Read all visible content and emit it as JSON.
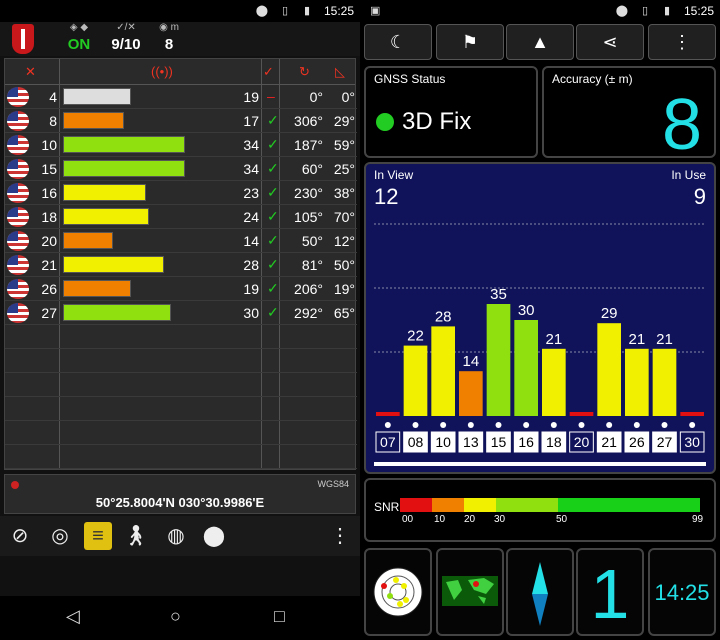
{
  "status_bar": {
    "time": "15:25",
    "battery": "battery-icon",
    "wifi": "vibrate-icon",
    "location": "location-icon"
  },
  "left": {
    "header": {
      "status_label": "ON",
      "sats_label": "9/10",
      "alt_label": "8"
    },
    "table": {
      "columns": [
        "sat-icon",
        "snr-icon",
        "used-icon",
        "azimuth-icon",
        "elevation-icon"
      ],
      "rows": [
        {
          "prn": "4",
          "snr": "19",
          "used": "",
          "az": "0°",
          "el": "0°",
          "snr_value": 19,
          "color": "#dddddd"
        },
        {
          "prn": "8",
          "snr": "17",
          "used": "✓",
          "az": "306°",
          "el": "29°",
          "snr_value": 17,
          "color": "#f08000"
        },
        {
          "prn": "10",
          "snr": "34",
          "used": "✓",
          "az": "187°",
          "el": "59°",
          "snr_value": 34,
          "color": "#90e010"
        },
        {
          "prn": "15",
          "snr": "34",
          "used": "✓",
          "az": "60°",
          "el": "25°",
          "snr_value": 34,
          "color": "#90e010"
        },
        {
          "prn": "16",
          "snr": "23",
          "used": "✓",
          "az": "230°",
          "el": "38°",
          "snr_value": 23,
          "color": "#f0f000"
        },
        {
          "prn": "18",
          "snr": "24",
          "used": "✓",
          "az": "105°",
          "el": "70°",
          "snr_value": 24,
          "color": "#f0f000"
        },
        {
          "prn": "20",
          "snr": "14",
          "used": "✓",
          "az": "50°",
          "el": "12°",
          "snr_value": 14,
          "color": "#f08000"
        },
        {
          "prn": "21",
          "snr": "28",
          "used": "✓",
          "az": "81°",
          "el": "50°",
          "snr_value": 28,
          "color": "#f0f000"
        },
        {
          "prn": "26",
          "snr": "19",
          "used": "✓",
          "az": "206°",
          "el": "19°",
          "snr_value": 19,
          "color": "#f08000"
        },
        {
          "prn": "27",
          "snr": "30",
          "used": "✓",
          "az": "292°",
          "el": "65°",
          "snr_value": 30,
          "color": "#90e010"
        }
      ]
    },
    "coords": {
      "datum": "WGS84",
      "value": "50°25.8004'N  030°30.9986'E"
    },
    "tools": [
      "compass-icon",
      "radar-icon",
      "table-icon",
      "walk-icon",
      "globe-icon",
      "pin-icon",
      "more-icon"
    ]
  },
  "right": {
    "toolbar": [
      "moon-icon",
      "person-flag-icon",
      "navigate-icon",
      "share-icon",
      "more-icon"
    ],
    "gnss": {
      "title": "GNSS Status",
      "fix": "3D Fix"
    },
    "accuracy": {
      "title": "Accuracy (± m)",
      "value": "8"
    },
    "chart": {
      "in_view_label": "In View",
      "in_view": "12",
      "in_use_label": "In Use",
      "in_use": "9"
    },
    "snr_scale": {
      "title": "SNR",
      "ticks": [
        "00",
        "10",
        "20",
        "30",
        "50",
        "99"
      ]
    },
    "big_number": "1",
    "clock": "14:25"
  },
  "chart_data": {
    "type": "bar",
    "categories": [
      "07",
      "08",
      "10",
      "13",
      "15",
      "16",
      "18",
      "20",
      "21",
      "26",
      "27",
      "30"
    ],
    "values": [
      0,
      22,
      28,
      14,
      35,
      30,
      21,
      0,
      29,
      21,
      21,
      0
    ],
    "data_labels": [
      "",
      "22",
      "28",
      "14",
      "35",
      "30",
      "21",
      "",
      "29",
      "21",
      "21",
      ""
    ],
    "ylim": [
      0,
      60
    ]
  }
}
